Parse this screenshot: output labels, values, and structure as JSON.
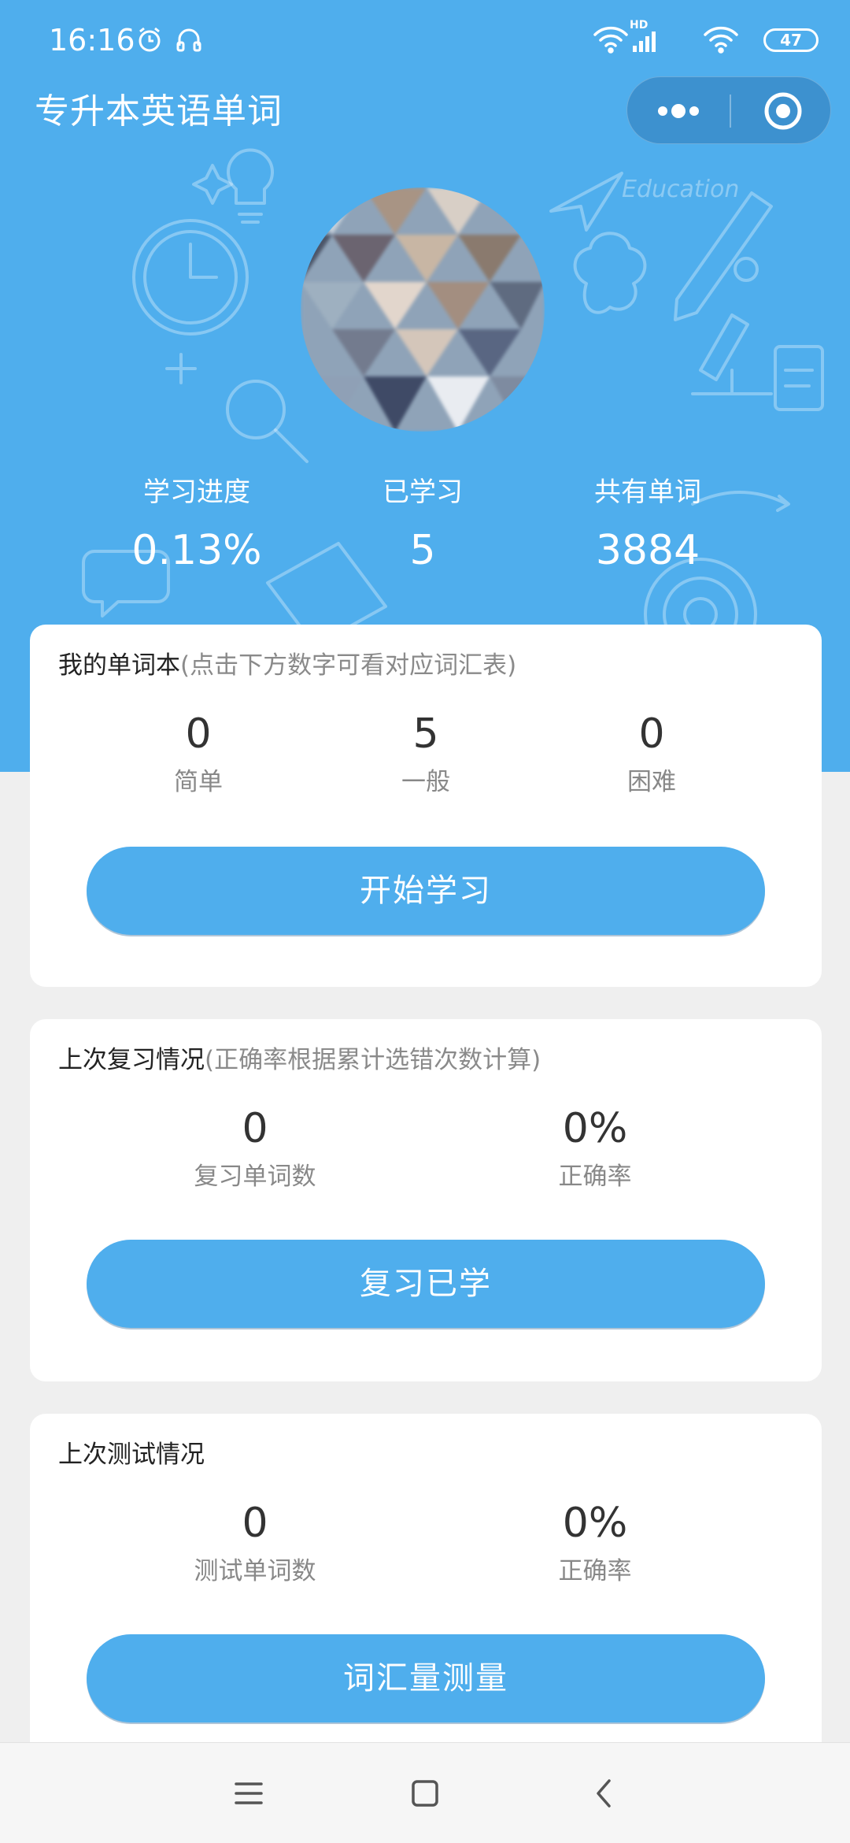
{
  "status_bar": {
    "time": "16:16",
    "battery": "47",
    "network_badge": "HD"
  },
  "nav": {
    "title": "专升本英语单词"
  },
  "stats": [
    {
      "label": "学习进度",
      "value": "0.13%"
    },
    {
      "label": "已学习",
      "value": "5"
    },
    {
      "label": "共有单词",
      "value": "3884"
    }
  ],
  "doodle_text": "Education",
  "wordbook": {
    "title": "我的单词本",
    "hint": "(点击下方数字可看对应词汇表)",
    "items": [
      {
        "value": "0",
        "label": "简单"
      },
      {
        "value": "5",
        "label": "一般"
      },
      {
        "value": "0",
        "label": "困难"
      }
    ],
    "button": "开始学习"
  },
  "review": {
    "title": "上次复习情况",
    "hint": "(正确率根据累计选错次数计算)",
    "items": [
      {
        "value": "0",
        "label": "复习单词数"
      },
      {
        "value": "0%",
        "label": "正确率"
      }
    ],
    "button": "复习已学"
  },
  "test": {
    "title": "上次测试情况",
    "items": [
      {
        "value": "0",
        "label": "测试单词数"
      },
      {
        "value": "0%",
        "label": "正确率"
      }
    ],
    "button": "词汇量测量"
  },
  "colors": {
    "primary": "#4faeed",
    "background": "#efefef",
    "card": "#ffffff",
    "text": "#333333",
    "muted": "#888888"
  }
}
